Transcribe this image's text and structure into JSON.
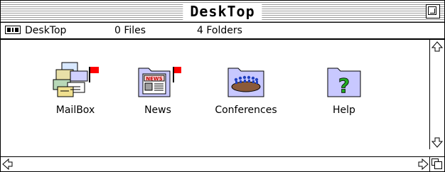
{
  "window": {
    "title": "DeskTop"
  },
  "infobar": {
    "location": "DeskTop",
    "files": "0 Files",
    "folders": "4 Folders",
    "location_icon": "disk-drive-icon"
  },
  "items": [
    {
      "label": "MailBox",
      "icon": "mailbox-folder-icon",
      "flagged": true
    },
    {
      "label": "News",
      "icon": "news-folder-icon",
      "flagged": true,
      "icon_text": "NEWS"
    },
    {
      "label": "Conferences",
      "icon": "conferences-folder-icon",
      "flagged": false
    },
    {
      "label": "Help",
      "icon": "help-folder-icon",
      "flagged": false,
      "icon_text": "?"
    }
  ],
  "colors": {
    "flag": "#ff0000",
    "folder": "#c8c8ff",
    "help_mark": "#22aa22",
    "stripes": "#9a9a9a"
  }
}
